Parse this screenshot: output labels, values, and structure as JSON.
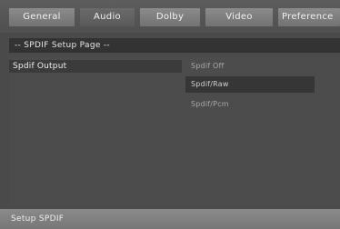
{
  "tabs": [
    {
      "label": "General"
    },
    {
      "label": "Audio"
    },
    {
      "label": "Dolby"
    },
    {
      "label": "Video"
    },
    {
      "label": "Preference"
    }
  ],
  "page_header": "-- SPDIF Setup Page --",
  "option": {
    "label": "Spdif Output"
  },
  "submenu": [
    {
      "label": "Spdif Off"
    },
    {
      "label": "Spdif/Raw"
    },
    {
      "label": "Spdif/Pcm"
    }
  ],
  "status": "Setup SPDIF"
}
